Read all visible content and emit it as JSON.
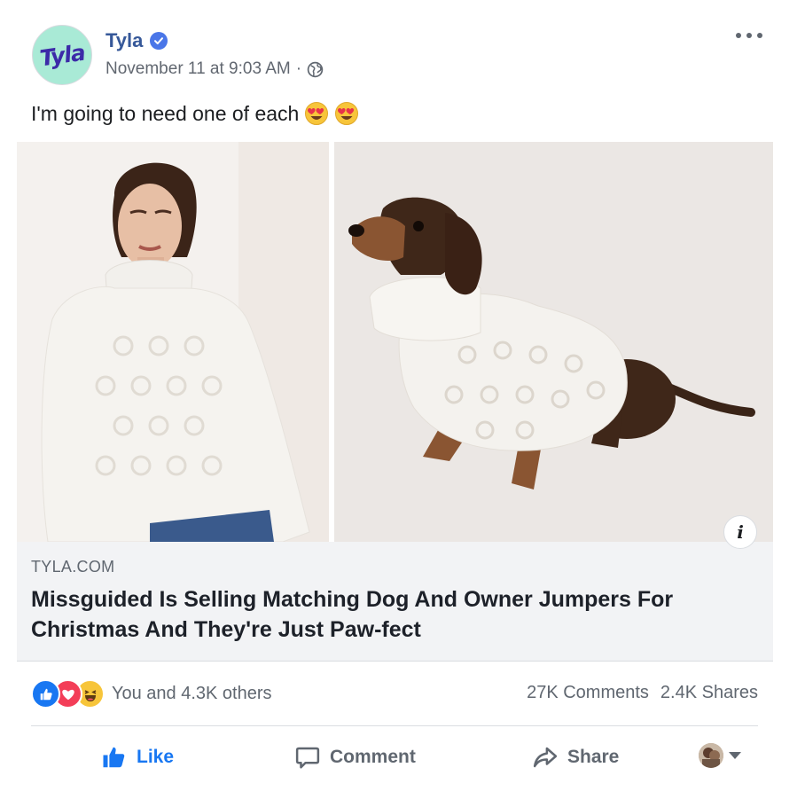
{
  "post": {
    "author": {
      "avatar_text": "Tyla",
      "name": "Tyla",
      "verified_icon": "verified-badge-icon"
    },
    "timestamp": "November 11 at 9:03 AM",
    "separator": "·",
    "privacy_icon": "globe-icon",
    "more_icon": "ellipsis-icon",
    "text": "I'm going to need one of each",
    "emojis": [
      "heart-eyes-emoji",
      "heart-eyes-emoji"
    ]
  },
  "link": {
    "domain": "TYLA.COM",
    "headline": "Missguided Is Selling Matching Dog And Owner Jumpers For Christmas And They're Just Paw-fect",
    "info_label": "i"
  },
  "stats": {
    "reaction_icons": [
      "like-reaction-icon",
      "love-reaction-icon",
      "haha-reaction-icon"
    ],
    "reactions_text": "You and 4.3K others",
    "comments": "27K Comments",
    "shares": "2.4K Shares"
  },
  "actions": {
    "like": "Like",
    "comment": "Comment",
    "share": "Share"
  },
  "colors": {
    "brand_link": "#365899",
    "like_blue": "#1877f2",
    "love_red": "#f33e58",
    "haha_yellow": "#f7c53a",
    "muted_text": "#606770",
    "link_box_bg": "#f2f3f5",
    "avatar_bg": "#a9ead6",
    "avatar_text": "#3c2aa8"
  }
}
